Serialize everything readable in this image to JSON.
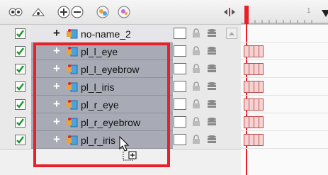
{
  "toolbar": {
    "buttons": [
      {
        "name": "show-all-icon"
      },
      {
        "name": "hide-all-icon"
      },
      {
        "name": "add-layer-icon"
      },
      {
        "name": "remove-layer-icon"
      },
      {
        "name": "add-peg-icon"
      },
      {
        "name": "add-drawing-icon"
      },
      {
        "name": "split-view-icon"
      }
    ]
  },
  "timeline": {
    "frame_number": "1"
  },
  "layers": [
    {
      "name": "no-name_2",
      "visible": true
    },
    {
      "name": "pl_l_eye",
      "visible": true
    },
    {
      "name": "pl_l_eyebrow",
      "visible": true
    },
    {
      "name": "pl_l_iris",
      "visible": true
    },
    {
      "name": "pl_r_eye",
      "visible": true
    },
    {
      "name": "pl_r_eyebrow",
      "visible": true
    },
    {
      "name": "pl_r_iris",
      "visible": true
    }
  ],
  "colors": {
    "selection": "#e8202a",
    "row_selected": "#a8aab5",
    "timeline_marker": "#e8202a"
  }
}
